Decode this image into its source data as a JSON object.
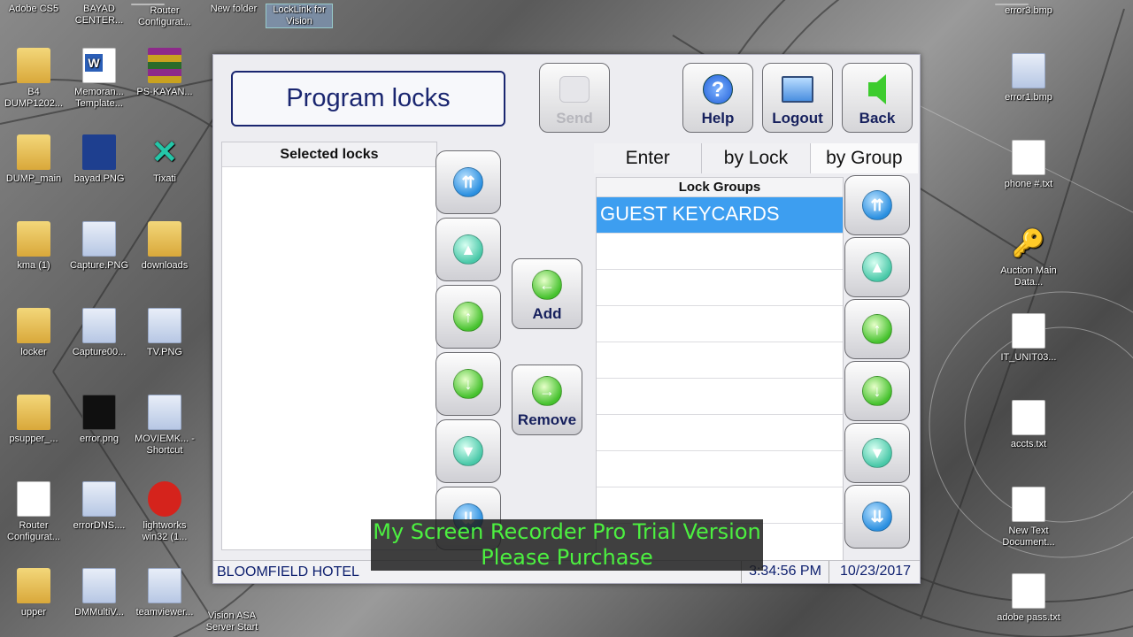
{
  "desktop": {
    "left_icons": [
      {
        "label": "Adobe CS5",
        "type": "folder"
      },
      {
        "label": "B4 DUMP1202...",
        "type": "folder"
      },
      {
        "label": "DUMP_main",
        "type": "folder"
      },
      {
        "label": "kma (1)",
        "type": "folder"
      },
      {
        "label": "locker",
        "type": "folder"
      },
      {
        "label": "psupper_...",
        "type": "folder"
      },
      {
        "label": "Router Configurat...",
        "type": "doc"
      },
      {
        "label": "upper",
        "type": "folder"
      }
    ],
    "col2_icons": [
      {
        "label": "BAYAD CENTER...",
        "type": "folder"
      },
      {
        "label": "Memoran... Template...",
        "type": "word"
      },
      {
        "label": "bayad.PNG",
        "type": "blue"
      },
      {
        "label": "Capture.PNG",
        "type": "img"
      },
      {
        "label": "Capture00...",
        "type": "img"
      },
      {
        "label": "error.png",
        "type": "dark"
      },
      {
        "label": "errorDNS....",
        "type": "img"
      },
      {
        "label": "DMMultiV...",
        "type": "img"
      }
    ],
    "col3_icons": [
      {
        "label": "Router Configurat...",
        "type": "doc"
      },
      {
        "label": "PS-KAYAN...",
        "type": "rar"
      },
      {
        "label": "Tixati",
        "type": "tix"
      },
      {
        "label": "downloads",
        "type": "folder"
      },
      {
        "label": "TV.PNG",
        "type": "img"
      },
      {
        "label": "MOVIEMK... - Shortcut",
        "type": "img"
      },
      {
        "label": "lightworks win32 (1...",
        "type": "red"
      },
      {
        "label": "teamviewer...",
        "type": "img"
      }
    ],
    "top_icons": [
      {
        "label": "New folder"
      },
      {
        "label": "LockLink for Vision"
      }
    ],
    "bottom_icon": "Vision ASA Server Start",
    "right_icons": [
      {
        "label": "error3.bmp",
        "type": "doc"
      },
      {
        "label": "error1.bmp",
        "type": "img"
      },
      {
        "label": "phone #.txt",
        "type": "doc"
      },
      {
        "label": "Auction Main Data...",
        "type": "key"
      },
      {
        "label": "IT_UNIT03...",
        "type": "doc"
      },
      {
        "label": "accts.txt",
        "type": "doc"
      },
      {
        "label": "New Text Document...",
        "type": "doc"
      },
      {
        "label": "adobe pass.txt",
        "type": "doc"
      }
    ]
  },
  "app": {
    "title": "Program locks",
    "toolbar": {
      "send_label": "Send",
      "help_label": "Help",
      "logout_label": "Logout",
      "back_label": "Back"
    },
    "selected_locks": {
      "header": "Selected locks",
      "items": []
    },
    "actions": {
      "add_label": "Add",
      "remove_label": "Remove"
    },
    "tabs": [
      {
        "label": "Enter",
        "active": false
      },
      {
        "label": "by Lock",
        "active": false
      },
      {
        "label": "by Group",
        "active": true
      }
    ],
    "lock_groups": {
      "header": "Lock Groups",
      "items": [
        "GUEST KEYCARDS"
      ],
      "selected_index": 0
    },
    "status": {
      "hotel": "BLOOMFIELD HOTEL",
      "time": "3:34:56 PM",
      "date": "10/23/2017"
    }
  },
  "watermark": {
    "line1": "My Screen Recorder Pro Trial Version",
    "line2": "Please Purchase"
  },
  "colors": {
    "title_border": "#1a2670",
    "selected_row": "#3d9ef0",
    "watermark_text": "#4cf040"
  }
}
